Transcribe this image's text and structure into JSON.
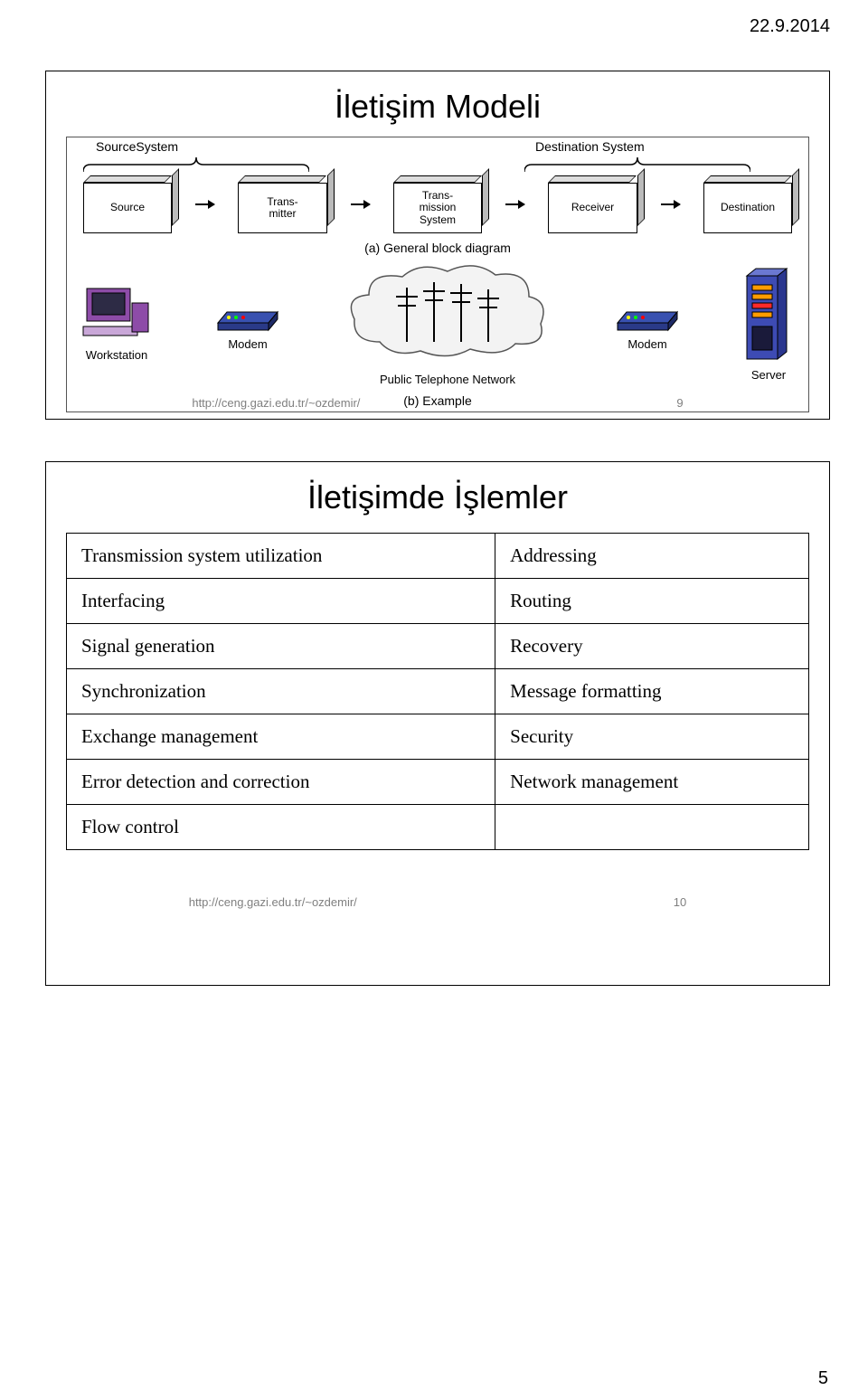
{
  "page": {
    "date": "22.9.2014",
    "number": "5"
  },
  "slide1": {
    "title": "İletişim Modeli",
    "sourceSystem": "SourceSystem",
    "destSystem": "Destination System",
    "boxes": {
      "source": "Source",
      "transmitter": "Trans-\nmitter",
      "transSystem": "Trans-\nmission\nSystem",
      "receiver": "Receiver",
      "destination": "Destination"
    },
    "captionA": "(a) General block diagram",
    "example": {
      "workstation": "Workstation",
      "modem1": "Modem",
      "ptn": "Public Telephone Network",
      "modem2": "Modem",
      "server": "Server"
    },
    "captionB": "(b) Example",
    "footerUrl": "http://ceng.gazi.edu.tr/~ozdemir/",
    "footerNum": "9"
  },
  "slide2": {
    "title": "İletişimde İşlemler",
    "rows": [
      [
        "Transmission system utilization",
        "Addressing"
      ],
      [
        "Interfacing",
        "Routing"
      ],
      [
        "Signal generation",
        "Recovery"
      ],
      [
        "Synchronization",
        "Message formatting"
      ],
      [
        "Exchange management",
        "Security"
      ],
      [
        "Error detection and correction",
        "Network management"
      ],
      [
        "Flow control",
        ""
      ]
    ],
    "footerUrl": "http://ceng.gazi.edu.tr/~ozdemir/",
    "footerNum": "10"
  }
}
